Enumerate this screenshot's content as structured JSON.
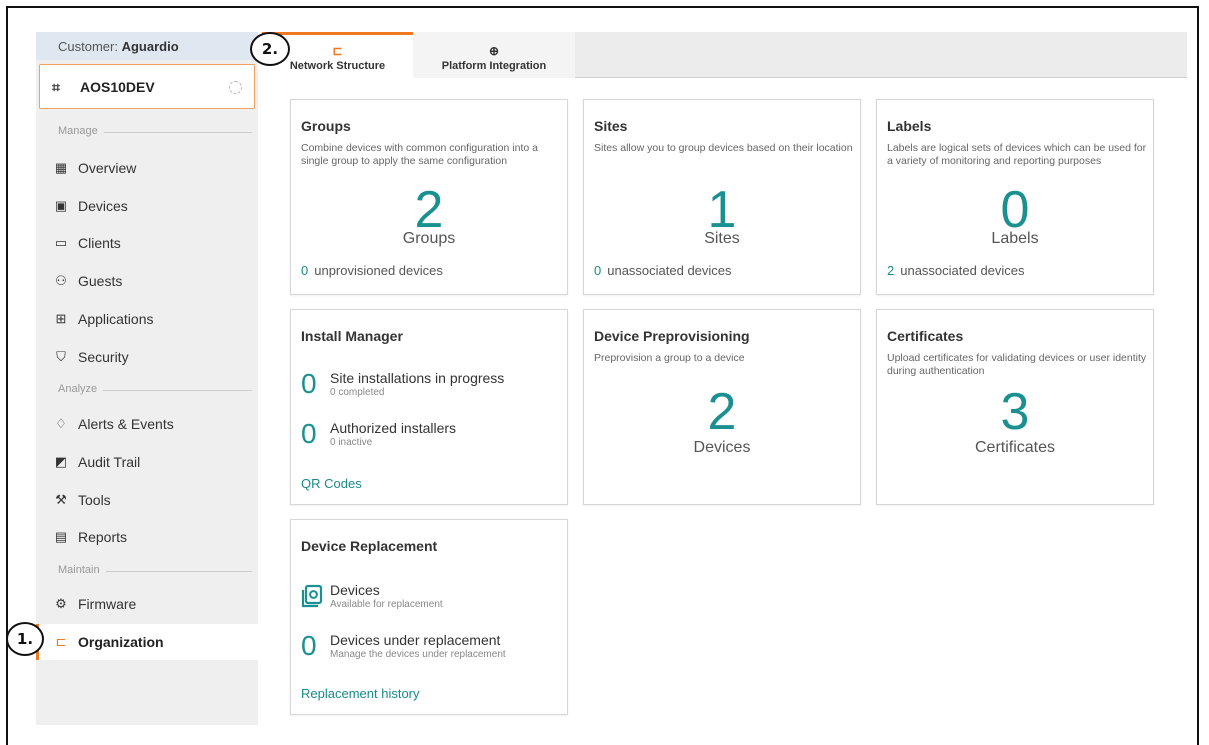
{
  "customer": {
    "prefix": "Customer: ",
    "name": "Aguardio"
  },
  "group_selector": {
    "icon": "network-group-icon",
    "name": "AOS10DEV"
  },
  "sections": {
    "manage": "Manage",
    "analyze": "Analyze",
    "maintain": "Maintain"
  },
  "nav": {
    "overview": {
      "label": "Overview",
      "icon": "overview-icon"
    },
    "devices": {
      "label": "Devices",
      "icon": "devices-icon"
    },
    "clients": {
      "label": "Clients",
      "icon": "clients-icon"
    },
    "guests": {
      "label": "Guests",
      "icon": "guests-icon"
    },
    "applications": {
      "label": "Applications",
      "icon": "applications-icon"
    },
    "security": {
      "label": "Security",
      "icon": "shield-icon"
    },
    "alerts": {
      "label": "Alerts & Events",
      "icon": "bell-icon"
    },
    "audit": {
      "label": "Audit Trail",
      "icon": "audit-icon"
    },
    "tools": {
      "label": "Tools",
      "icon": "wrench-icon"
    },
    "reports": {
      "label": "Reports",
      "icon": "reports-icon"
    },
    "firmware": {
      "label": "Firmware",
      "icon": "firmware-icon"
    },
    "organization": {
      "label": "Organization",
      "icon": "org-tree-icon"
    }
  },
  "tabs": {
    "network_structure": "Network Structure",
    "platform_integration": "Platform Integration"
  },
  "cards": {
    "groups": {
      "title": "Groups",
      "desc": "Combine devices with common configuration into a single group to apply the same configuration",
      "count": "2",
      "count_label": "Groups",
      "footer_num": "0",
      "footer_text": "unprovisioned devices"
    },
    "sites": {
      "title": "Sites",
      "desc": "Sites allow you to group devices based on their location",
      "count": "1",
      "count_label": "Sites",
      "footer_num": "0",
      "footer_text": "unassociated devices"
    },
    "labels": {
      "title": "Labels",
      "desc": "Labels are logical sets of devices which can be used for a variety of monitoring and reporting purposes",
      "count": "0",
      "count_label": "Labels",
      "footer_num": "2",
      "footer_text": "unassociated devices"
    },
    "install": {
      "title": "Install Manager",
      "row1_num": "0",
      "row1_title": "Site installations in progress",
      "row1_sub": "0 completed",
      "row2_num": "0",
      "row2_title": "Authorized installers",
      "row2_sub": "0 inactive",
      "link": "QR Codes"
    },
    "preprov": {
      "title": "Device Preprovisioning",
      "desc": "Preprovision a group to a device",
      "count": "2",
      "count_label": "Devices"
    },
    "certs": {
      "title": "Certificates",
      "desc": "Upload certificates for validating devices or user identity during authentication",
      "count": "3",
      "count_label": "Certificates"
    },
    "replacement": {
      "title": "Device Replacement",
      "row1_title": "Devices",
      "row1_sub": "Available for replacement",
      "row2_num": "0",
      "row2_title": "Devices under replacement",
      "row2_sub": "Manage the devices under replacement",
      "link": "Replacement history"
    }
  },
  "callouts": {
    "one": "1.",
    "two": "2."
  },
  "colors": {
    "accent": "#f07820",
    "teal": "#1a9090"
  }
}
